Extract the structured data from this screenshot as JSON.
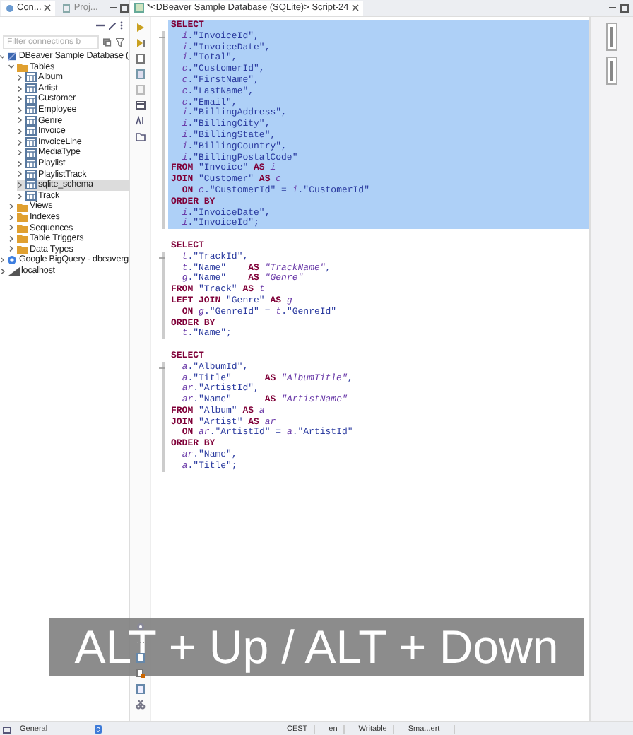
{
  "navigator": {
    "tabs": [
      {
        "label": "Con...",
        "selected": true
      },
      {
        "label": "Proj...",
        "selected": false
      }
    ],
    "filter": {
      "placeholder": "Filter connections b"
    },
    "tree": [
      {
        "kind": "db",
        "label": "DBeaver Sample Database (",
        "expanded": true,
        "selected": false,
        "children": [
          {
            "kind": "folder",
            "label": "Tables",
            "expanded": true,
            "selected": false,
            "children": [
              {
                "kind": "table",
                "label": "Album",
                "expanded": false,
                "selected": false
              },
              {
                "kind": "table",
                "label": "Artist",
                "expanded": false,
                "selected": false
              },
              {
                "kind": "table",
                "label": "Customer",
                "expanded": false,
                "selected": false
              },
              {
                "kind": "table",
                "label": "Employee",
                "expanded": false,
                "selected": false
              },
              {
                "kind": "table",
                "label": "Genre",
                "expanded": false,
                "selected": false
              },
              {
                "kind": "table",
                "label": "Invoice",
                "expanded": false,
                "selected": false
              },
              {
                "kind": "table",
                "label": "InvoiceLine",
                "expanded": false,
                "selected": false
              },
              {
                "kind": "table",
                "label": "MediaType",
                "expanded": false,
                "selected": false
              },
              {
                "kind": "table",
                "label": "Playlist",
                "expanded": false,
                "selected": false
              },
              {
                "kind": "table",
                "label": "PlaylistTrack",
                "expanded": false,
                "selected": false
              },
              {
                "kind": "table",
                "label": "sqlite_schema",
                "expanded": false,
                "selected": true
              },
              {
                "kind": "table",
                "label": "Track",
                "expanded": false,
                "selected": false
              }
            ]
          },
          {
            "kind": "folder",
            "label": "Views",
            "expanded": false,
            "selected": false
          },
          {
            "kind": "folder",
            "label": "Indexes",
            "expanded": false,
            "selected": false
          },
          {
            "kind": "folder",
            "label": "Sequences",
            "expanded": false,
            "selected": false
          },
          {
            "kind": "folder",
            "label": "Table Triggers",
            "expanded": false,
            "selected": false
          },
          {
            "kind": "folder",
            "label": "Data Types",
            "expanded": false,
            "selected": false
          }
        ]
      },
      {
        "kind": "cloud",
        "label": "Google BigQuery - dbeaverg",
        "expanded": false,
        "selected": false
      },
      {
        "kind": "server",
        "label": "localhost",
        "expanded": false,
        "selected": false
      }
    ]
  },
  "editor": {
    "tab": {
      "label": "*<DBeaver Sample Database (SQLite)> Script-24",
      "selected": true
    },
    "statements": [
      {
        "selected": true,
        "lines": [
          "**SELECT**",
          "  *i*.\"InvoiceId\",",
          "  *i*.\"InvoiceDate\",",
          "  *i*.\"Total\",",
          "  *c*.\"CustomerId\",",
          "  *c*.\"FirstName\",",
          "  *c*.\"LastName\",",
          "  *c*.\"Email\",",
          "  *i*.\"BillingAddress\",",
          "  *i*.\"BillingCity\",",
          "  *i*.\"BillingState\",",
          "  *i*.\"BillingCountry\",",
          "  *i*.\"BillingPostalCode\"",
          "**FROM** \"Invoice\" **AS** *i*",
          "**JOIN** \"Customer\" **AS** *c*",
          "  **ON** *c*.\"CustomerId\" = *i*.\"CustomerId\"",
          "**ORDER BY**",
          "  *i*.\"InvoiceDate\",",
          "  *i*.\"InvoiceId\";"
        ]
      },
      {
        "selected": false,
        "lines": [
          "**SELECT**",
          "  *t*.\"TrackId\",",
          "  *t*.\"Name\"    **AS** *\"TrackName\"*,",
          "  *g*.\"Name\"    **AS** *\"Genre\"*",
          "**FROM** \"Track\" **AS** *t*",
          "**LEFT JOIN** \"Genre\" **AS** *g*",
          "  **ON** *g*.\"GenreId\" = *t*.\"GenreId\"",
          "**ORDER BY**",
          "  *t*.\"Name\";"
        ]
      },
      {
        "selected": false,
        "lines": [
          "**SELECT**",
          "  *a*.\"AlbumId\",",
          "  *a*.\"Title\"      **AS** *\"AlbumTitle\"*,",
          "  *ar*.\"ArtistId\",",
          "  *ar*.\"Name\"      **AS** *\"ArtistName\"*",
          "**FROM** \"Album\" **AS** *a*",
          "**JOIN** \"Artist\" **AS** *ar*",
          "  **ON** *ar*.\"ArtistId\" = *a*.\"ArtistId\"",
          "**ORDER BY**",
          "  *ar*.\"Name\",",
          "  *a*.\"Title\";"
        ]
      }
    ]
  },
  "caption": "ALT + Up / ALT + Down",
  "status_bar": {
    "profile": "General",
    "items": [
      "CEST",
      "en",
      "Writable",
      "Sma...ert"
    ]
  }
}
